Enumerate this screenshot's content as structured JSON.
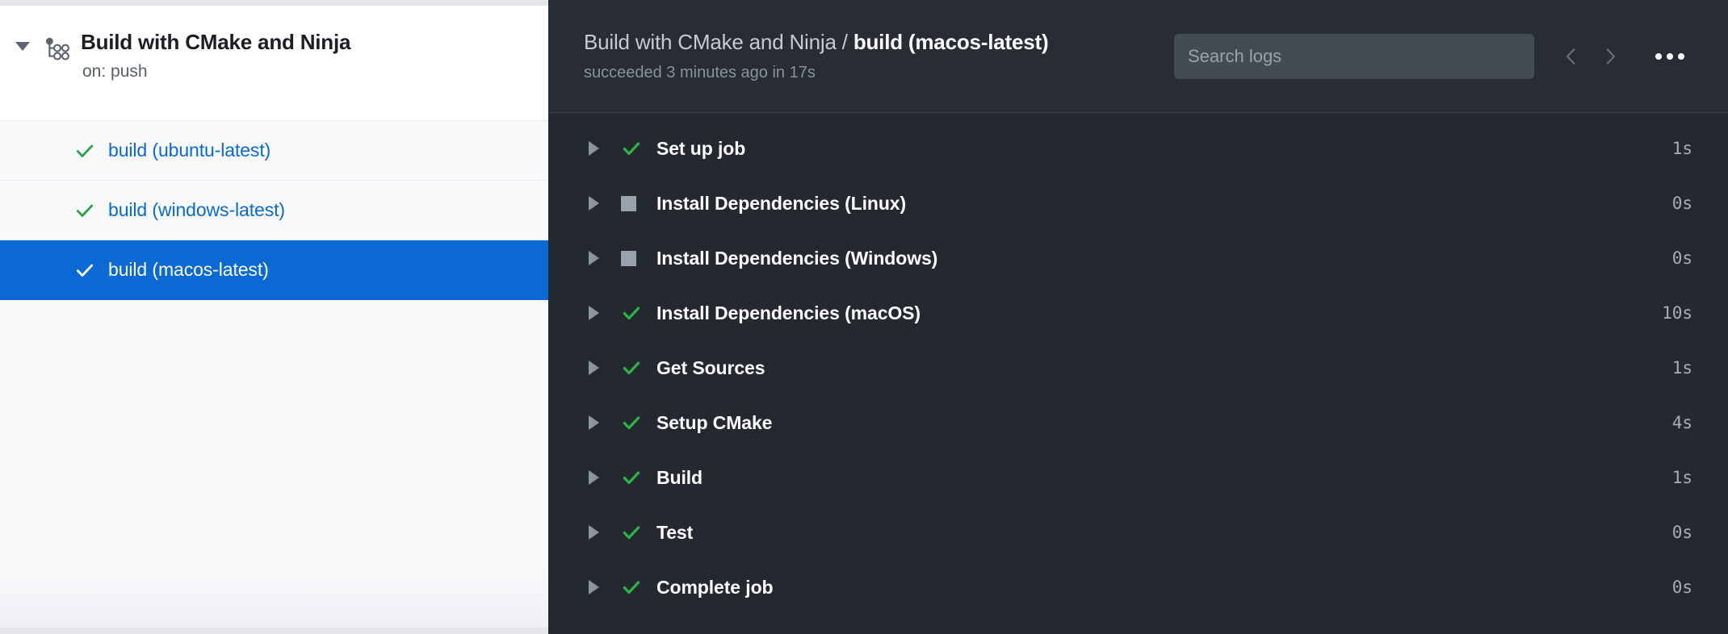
{
  "colors": {
    "accent_blue": "#0b69d4",
    "link_blue": "#0969da",
    "success_green": "#2aa44a",
    "skipped_gray": "#99a1ad",
    "panel_dark": "#24282f",
    "panel_header_dark": "#272c35",
    "sidebar_bg": "#f8f9fb"
  },
  "sidebar": {
    "workflow": {
      "title": "Build with CMake and Ninja",
      "trigger": "on: push",
      "caret_icon": "chevron-down-icon",
      "workflow_icon": "workflow-graph-icon"
    },
    "jobs": [
      {
        "label": "build (ubuntu-latest)",
        "status": "success",
        "status_icon": "check-icon",
        "selected": false
      },
      {
        "label": "build (windows-latest)",
        "status": "success",
        "status_icon": "check-icon",
        "selected": false
      },
      {
        "label": "build (macos-latest)",
        "status": "success",
        "status_icon": "check-icon",
        "selected": true
      }
    ]
  },
  "logs": {
    "breadcrumb": {
      "parent": "Build with CMake and Ninja / ",
      "current": "build (macos-latest)"
    },
    "status_line": "succeeded 3 minutes ago in 17s",
    "search": {
      "placeholder": "Search logs",
      "value": ""
    },
    "toolbar": {
      "prev_icon": "chevron-left-icon",
      "next_icon": "chevron-right-icon",
      "more_icon": "ellipsis-icon"
    },
    "steps": [
      {
        "name": "Set up job",
        "status": "success",
        "status_icon": "check-icon",
        "duration": "1s",
        "expander_icon": "triangle-right-icon"
      },
      {
        "name": "Install Dependencies (Linux)",
        "status": "skipped",
        "status_icon": "square-icon",
        "duration": "0s",
        "expander_icon": "triangle-right-icon"
      },
      {
        "name": "Install Dependencies (Windows)",
        "status": "skipped",
        "status_icon": "square-icon",
        "duration": "0s",
        "expander_icon": "triangle-right-icon"
      },
      {
        "name": "Install Dependencies (macOS)",
        "status": "success",
        "status_icon": "check-icon",
        "duration": "10s",
        "expander_icon": "triangle-right-icon"
      },
      {
        "name": "Get Sources",
        "status": "success",
        "status_icon": "check-icon",
        "duration": "1s",
        "expander_icon": "triangle-right-icon"
      },
      {
        "name": "Setup CMake",
        "status": "success",
        "status_icon": "check-icon",
        "duration": "4s",
        "expander_icon": "triangle-right-icon"
      },
      {
        "name": "Build",
        "status": "success",
        "status_icon": "check-icon",
        "duration": "1s",
        "expander_icon": "triangle-right-icon"
      },
      {
        "name": "Test",
        "status": "success",
        "status_icon": "check-icon",
        "duration": "0s",
        "expander_icon": "triangle-right-icon"
      },
      {
        "name": "Complete job",
        "status": "success",
        "status_icon": "check-icon",
        "duration": "0s",
        "expander_icon": "triangle-right-icon"
      }
    ]
  }
}
